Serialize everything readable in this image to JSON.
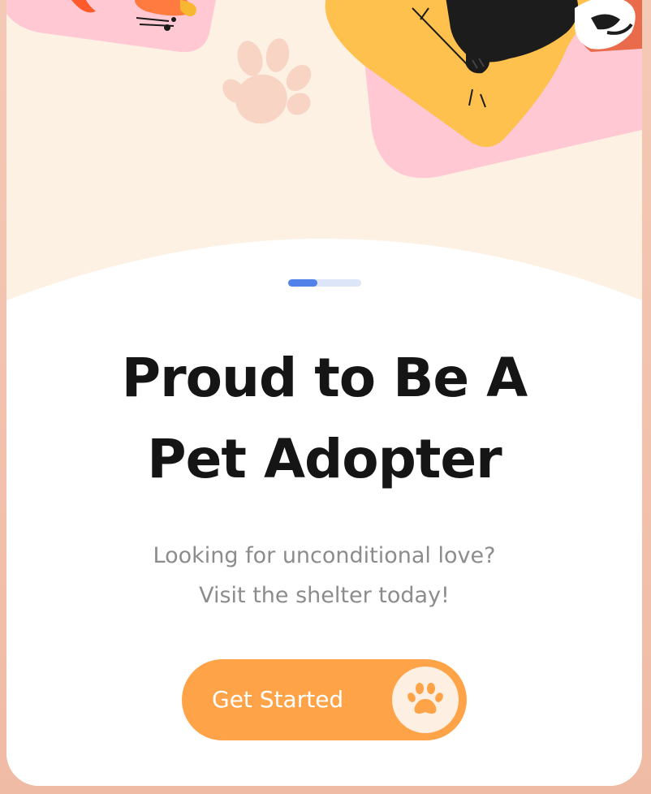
{
  "onboarding": {
    "title_line_1": "Proud to Be A",
    "title_line_2": "Pet Adopter",
    "subtitle_line_1": "Looking for unconditional love?",
    "subtitle_line_2": "Visit the shelter today!",
    "cta_label": "Get Started",
    "cta_icon": "paw-icon",
    "page_progress": 0.4
  },
  "colors": {
    "accent": "#ffa349",
    "progress_active": "#5082ea",
    "progress_track": "#dde6f8",
    "title": "#151515",
    "subtitle": "#8c8c8c",
    "hero_background": "#fdf1e4"
  }
}
